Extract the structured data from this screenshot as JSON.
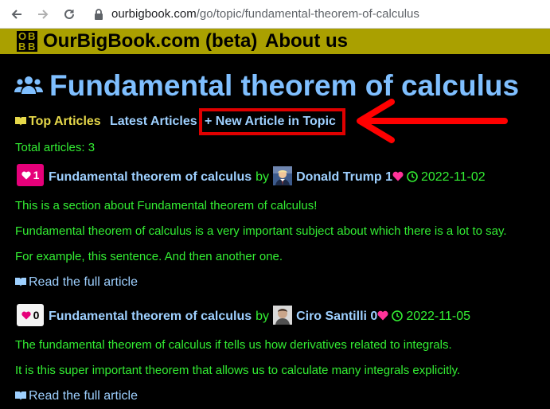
{
  "browser": {
    "url_host": "ourbigbook.com",
    "url_path": "/go/topic/fundamental-theorem-of-calculus"
  },
  "site": {
    "logo_letters": [
      "O",
      "B",
      "B",
      "B"
    ],
    "brand": "OurBigBook.com (beta)",
    "about": "About us"
  },
  "page": {
    "title": "Fundamental theorem of calculus",
    "tabs": {
      "top": "Top Articles",
      "latest": "Latest Articles",
      "new": "+ New Article in Topic"
    },
    "total": "Total articles: 3"
  },
  "articles": [
    {
      "likes": "1",
      "title": "Fundamental theorem of calculus",
      "by": "by",
      "author": "Donald Trump",
      "author_score": "1",
      "date": "2022-11-02",
      "body": [
        "This is a section about Fundamental theorem of calculus!",
        "Fundamental theorem of calculus is a very important subject about which there is a lot to say.",
        "For example, this sentence. And then another one."
      ],
      "read_more": "Read the full article"
    },
    {
      "likes": "0",
      "title": "Fundamental theorem of calculus",
      "by": "by",
      "author": "Ciro Santilli",
      "author_score": "0",
      "date": "2022-11-05",
      "body": [
        "The fundamental theorem of calculus if tells us how derivatives related to integrals.",
        "It is this super important theorem that allows us to calculate many integrals explicitly."
      ],
      "read_more": "Read the full article"
    }
  ],
  "colors": {
    "header_bg": "#aaa000",
    "title": "#7fbfff",
    "link": "#9ed0ff",
    "text": "#33ee33",
    "highlight": "#e00000",
    "like": "#e6007a"
  },
  "icons": [
    "back-arrow-icon",
    "forward-arrow-icon",
    "reload-icon",
    "lock-icon",
    "users-icon",
    "book-open-icon",
    "heart-icon",
    "clock-icon"
  ]
}
